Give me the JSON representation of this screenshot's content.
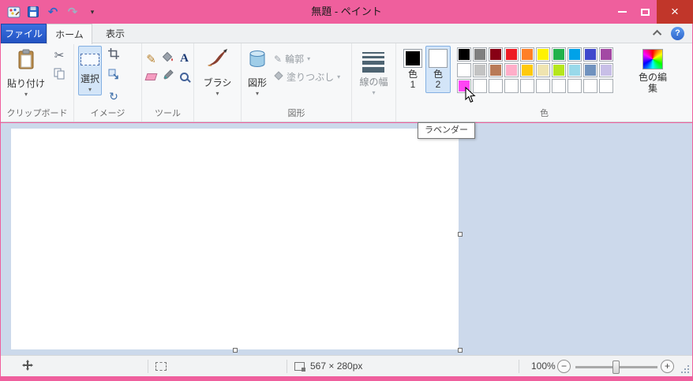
{
  "window": {
    "title": "無題 - ペイント",
    "accent": "#ef5f9d",
    "close_glyph": "×"
  },
  "tabs": {
    "file": "ファイル",
    "home": "ホーム",
    "view": "表示"
  },
  "ribbon": {
    "clipboard": {
      "group_label": "クリップボード",
      "paste_label": "貼り付け"
    },
    "image": {
      "group_label": "イメージ",
      "select_label": "選択"
    },
    "tools": {
      "group_label": "ツール",
      "text_glyph": "A"
    },
    "brushes": {
      "button_label": "ブラシ"
    },
    "shapes": {
      "group_label": "図形",
      "button_label": "図形",
      "outline_label": "輪郭",
      "fill_label": "塗りつぶし"
    },
    "size": {
      "button_label": "線の幅"
    },
    "colors": {
      "group_label": "色",
      "color1_label": "色1",
      "color2_label": "色2",
      "edit_label": "色の編集",
      "color1_value": "#000000",
      "color2_value": "#ffffff",
      "palette_rows": [
        [
          "#000000",
          "#7f7f7f",
          "#880015",
          "#ed1c24",
          "#ff7f27",
          "#fff200",
          "#22b14c",
          "#00a2e8",
          "#3f48cc",
          "#a349a4"
        ],
        [
          "#ffffff",
          "#c3c3c3",
          "#b97a57",
          "#ffaec9",
          "#ffc90e",
          "#efe4b0",
          "#b5e61d",
          "#99d9ea",
          "#7092be",
          "#c8bfe7"
        ],
        [
          "#ff45f5",
          "",
          "",
          "",
          "",
          "",
          "",
          "",
          "",
          ""
        ]
      ]
    }
  },
  "tooltip": {
    "text": "ラベンダー"
  },
  "statusbar": {
    "canvas_size": "567 × 280px",
    "zoom": "100%"
  },
  "icons": {
    "scissors": "✂",
    "undo": "↶",
    "redo": "↷",
    "rotate": "↻",
    "pencil": "✎",
    "dropdown": "▾",
    "help": "?",
    "minus": "−",
    "plus": "+"
  }
}
